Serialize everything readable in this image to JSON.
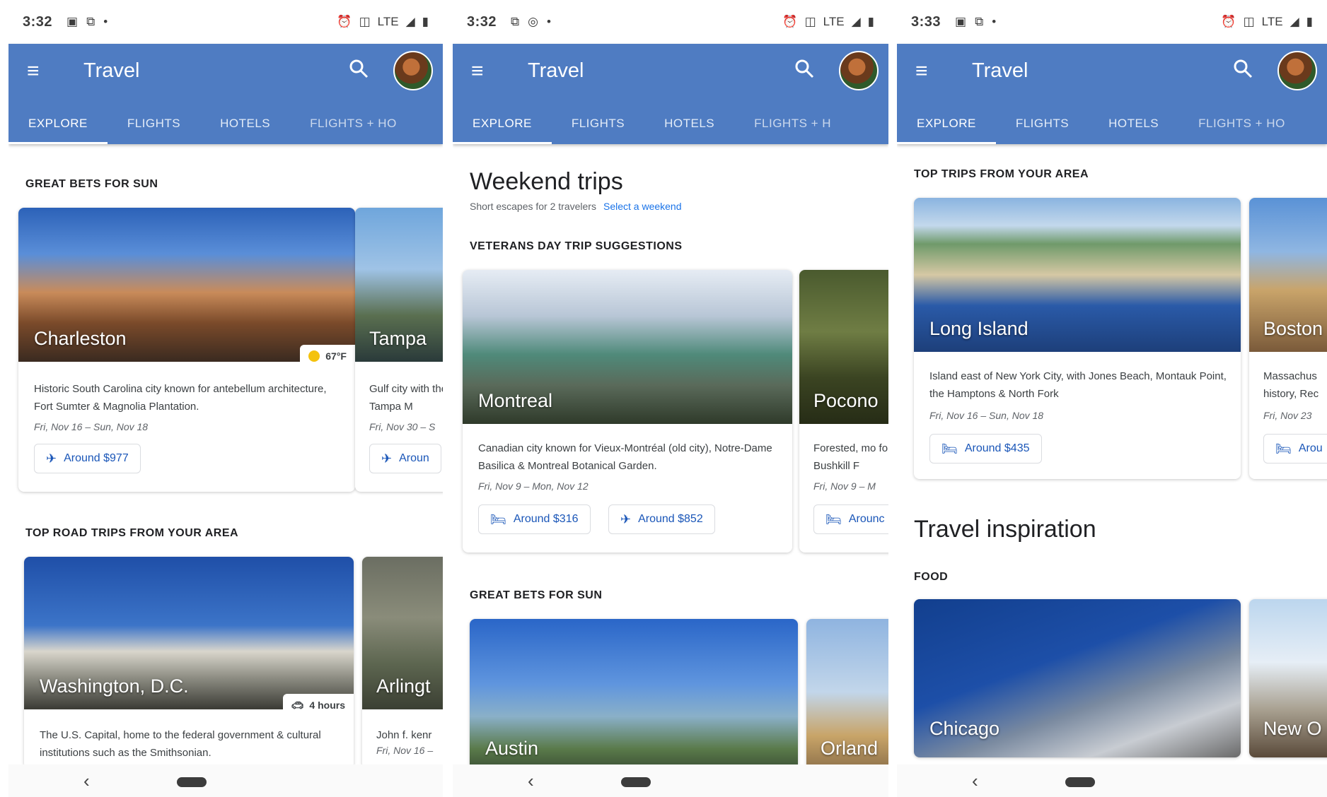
{
  "phones": [
    {
      "status": {
        "time": "3:32",
        "notif_icons": [
          "photo-icon",
          "cast-icon",
          "dot-icon"
        ],
        "sys_text": "LTE"
      },
      "appbar": {
        "title": "Travel"
      },
      "tabs": [
        "EXPLORE",
        "FLIGHTS",
        "HOTELS",
        "FLIGHTS + HO"
      ],
      "sections": [
        {
          "label": "GREAT BETS FOR SUN"
        },
        {
          "label": "TOP ROAD TRIPS FROM YOUR AREA"
        }
      ],
      "cards": [
        {
          "place": "Charleston",
          "badge": "67°F",
          "desc": "Historic South Carolina city known for antebellum architecture, Fort Sumter & Magnolia Plantation.",
          "date": "Fri, Nov 16 – Sun, Nov 18",
          "pill": "Around $977"
        },
        {
          "place": "Tampa",
          "desc": "Gulf city with the Tampa M",
          "date": "Fri, Nov 30 – S",
          "pill": "Aroun"
        },
        {
          "place": "Washington, D.C.",
          "badge": "4 hours",
          "desc": "The U.S. Capital, home to the federal government & cultural institutions such as the Smithsonian."
        },
        {
          "place": "Arlingt",
          "desc": "John f. kenr",
          "date": "Fri, Nov 16 –"
        }
      ]
    },
    {
      "status": {
        "time": "3:32",
        "notif_icons": [
          "cast-icon",
          "instagram-icon",
          "dot-icon"
        ],
        "sys_text": "LTE"
      },
      "appbar": {
        "title": "Travel"
      },
      "tabs": [
        "EXPLORE",
        "FLIGHTS",
        "HOTELS",
        "FLIGHTS + H"
      ],
      "heading": {
        "title": "Weekend trips",
        "subtitle": "Short escapes for 2 travelers",
        "link": "Select a weekend"
      },
      "sections": [
        {
          "label": "VETERANS DAY TRIP SUGGESTIONS"
        },
        {
          "label": "GREAT BETS FOR SUN"
        }
      ],
      "cards": [
        {
          "place": "Montreal",
          "desc": "Canadian city known for Vieux-Montréal (old city), Notre-Dame Basilica & Montreal Botanical Garden.",
          "date": "Fri, Nov 9 – Mon, Nov 12",
          "pill1": "Around $316",
          "pill2": "Around $852"
        },
        {
          "place": "Pocono",
          "desc": "Forested, mo for Bushkill F",
          "date": "Fri, Nov 9 – M",
          "pill": "Arounc"
        },
        {
          "place": "Austin"
        },
        {
          "place": "Orland"
        }
      ]
    },
    {
      "status": {
        "time": "3:33",
        "notif_icons": [
          "photo-icon",
          "cast-icon",
          "dot-icon"
        ],
        "sys_text": "LTE"
      },
      "appbar": {
        "title": "Travel"
      },
      "tabs": [
        "EXPLORE",
        "FLIGHTS",
        "HOTELS",
        "FLIGHTS + HO"
      ],
      "heading": {
        "title": "Travel inspiration"
      },
      "sections": [
        {
          "label": "TOP TRIPS FROM YOUR AREA"
        },
        {
          "label": "FOOD"
        }
      ],
      "cards": [
        {
          "place": "Long Island",
          "desc": "Island east of New York City, with Jones Beach, Montauk Point, the Hamptons & North Fork",
          "date": "Fri, Nov 16 – Sun, Nov 18",
          "pill": "Around $435"
        },
        {
          "place": "Boston",
          "desc": "Massachus history, Rec",
          "date": "Fri, Nov 23",
          "pill": "Arou"
        },
        {
          "place": "Chicago"
        },
        {
          "place": "New O"
        }
      ]
    }
  ]
}
